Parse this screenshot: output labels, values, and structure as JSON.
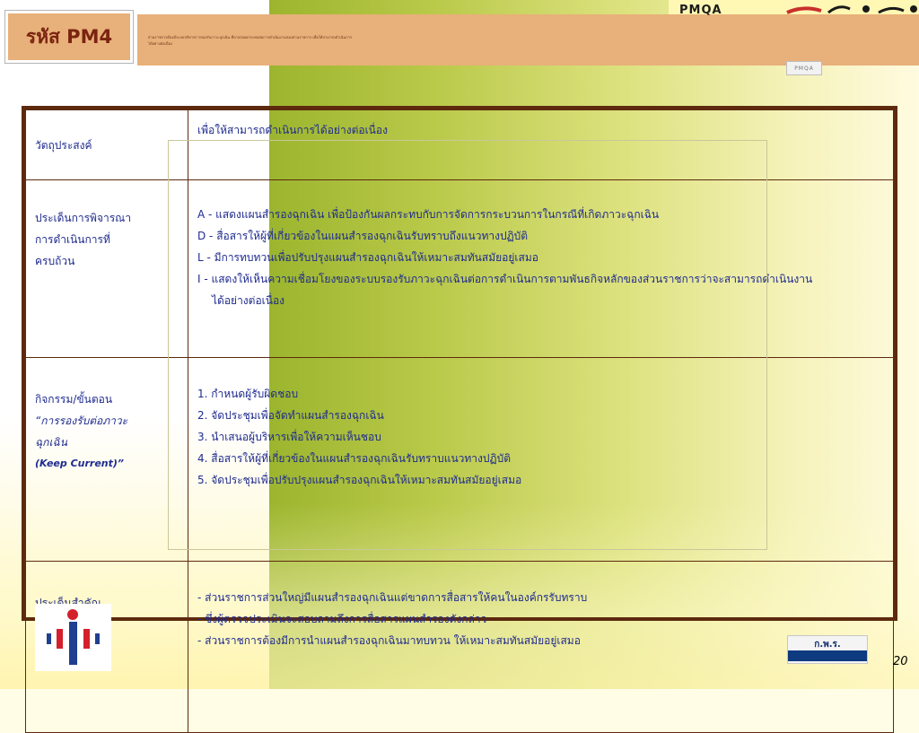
{
  "slide": {
    "code_label": "รหัส PM4",
    "header_description": "ส่วนราชการต้องมีระบบบริหารการรองรับภาวะฉุกเฉิน ที่อาจส่งผลกระทบต่อการดำเนินงานของส่วนราชการ เพื่อให้สามารถดำเนินการได้อย่างต่อเนื่อง",
    "pmqa_label": "PMQA",
    "pmqa_badge": "PMQA",
    "page_number": "20",
    "org_logo_text": "ก.พ.ร."
  },
  "table": {
    "rows": [
      {
        "label_lines": [
          "วัตถุประสงค์"
        ],
        "content_lines": [
          "เพื่อให้สามารถดำเนินการได้อย่างต่อเนื่อง"
        ]
      },
      {
        "label_lines": [
          "ประเด็นการพิจารณา",
          "การดำเนินการที่",
          "ครบถ้วน"
        ],
        "content_lines": [
          "A - แสดงแผนสำรองฉุกเฉิน เพื่อป้องกันผลกระทบกับการจัดการกระบวนการในกรณีที่เกิดภาวะฉุกเฉิน",
          "D - สื่อสารให้ผู้ที่เกี่ยวข้องในแผนสำรองฉุกเฉินรับทราบถึงแนวทางปฏิบัติ",
          "L - มีการทบทวนเพื่อปรับปรุงแผนสำรองฉุกเฉินให้เหมาะสมทันสมัยอยู่เสมอ",
          "I  - แสดงให้เห็นความเชื่อมโยงของระบบรองรับภาวะฉุกเฉินต่อการดำเนินการตามพันธกิจหลักของส่วนราชการว่าจะสามารถดำเนินงาน",
          "ได้อย่างต่อเนื่อง"
        ]
      },
      {
        "label_lines": [
          "กิจกรรม/ขั้นตอน",
          "“การรองรับต่อภาวะ",
          "ฉุกเฉิน",
          "(Keep Current)”"
        ],
        "content_lines": [
          "1. กำหนดผู้รับผิดชอบ",
          "2. จัดประชุมเพื่อจัดทำแผนสำรองฉุกเฉิน",
          "3. นำเสนอผู้บริหารเพื่อให้ความเห็นชอบ",
          "4. สื่อสารให้ผู้ที่เกี่ยวข้องในแผนสำรองฉุกเฉินรับทราบแนวทางปฏิบัติ",
          "5. จัดประชุมเพื่อปรับปรุงแผนสำรองฉุกเฉินให้เหมาะสมทันสมัยอยู่เสมอ"
        ]
      },
      {
        "label_lines": [
          "ประเด็นสำคัญ"
        ],
        "content_lines": [
          "- ส่วนราชการส่วนใหญ่มีแผนสำรองฉุกเฉินแต่ขาดการสื่อสารให้คนในองค์กรรับทราบ",
          "- ซึ่งผู้ตรวจประเมินจะสอบถามถึงการสื่อสารแผนสำรองดังกล่าว",
          "- ส่วนราชการต้องมีการนำแผนสำรองฉุกเฉินมาทบทวน ให้เหมาะสมทันสมัยอยู่เสมอ"
        ]
      }
    ]
  },
  "colors": {
    "header_bar": "#e8b07a",
    "title_text": "#7a2410",
    "table_border": "#5d2a0e",
    "body_text": "#1f2b8f",
    "logo_blue": "#1f3f8f",
    "logo_red": "#d3202a"
  },
  "icons": {
    "left_logo": "opdc-logo-icon",
    "top_right_logo": "pmqa-swoosh-icon",
    "bottom_right_logo": "ocsc-logo-icon"
  }
}
